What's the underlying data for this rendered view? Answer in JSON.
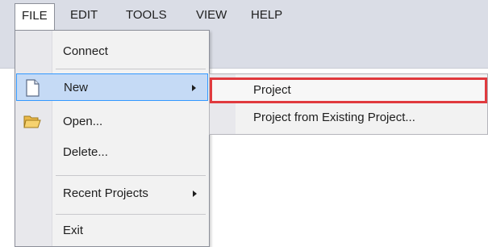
{
  "menubar": {
    "items": [
      {
        "label": "FILE",
        "active": true
      },
      {
        "label": "EDIT",
        "active": false
      },
      {
        "label": "TOOLS",
        "active": false
      },
      {
        "label": "VIEW",
        "active": false
      },
      {
        "label": "HELP",
        "active": false
      }
    ]
  },
  "file_menu": {
    "items": [
      {
        "label": "Connect",
        "icon": null,
        "has_submenu": false
      },
      {
        "label": "New",
        "icon": "new-file-icon",
        "has_submenu": true,
        "hovered": true
      },
      {
        "label": "Open...",
        "icon": "open-folder-icon",
        "has_submenu": false
      },
      {
        "label": "Delete...",
        "icon": null,
        "has_submenu": false
      },
      {
        "label": "Recent Projects",
        "icon": null,
        "has_submenu": true
      },
      {
        "label": "Exit",
        "icon": null,
        "has_submenu": false
      }
    ]
  },
  "new_submenu": {
    "items": [
      {
        "label": "Project",
        "highlighted": true
      },
      {
        "label": "Project from Existing Project...",
        "highlighted": false
      }
    ]
  },
  "colors": {
    "chrome": "#dadde6",
    "menu_bg": "#f2f2f2",
    "hover_bg": "#c5daf5",
    "hover_border": "#3399ff",
    "highlight_border": "#e03a3e"
  }
}
